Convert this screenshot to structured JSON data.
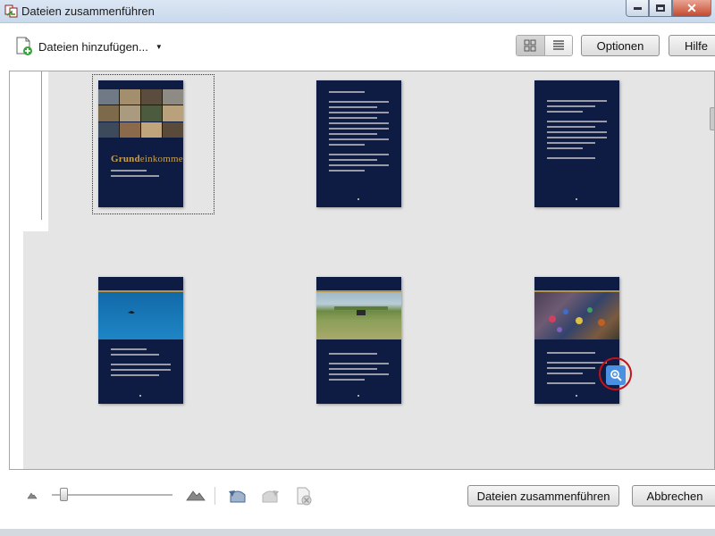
{
  "window": {
    "title": "Dateien zusammenführen",
    "controls": [
      "minimize-icon",
      "maximize-icon",
      "close-icon"
    ],
    "close_glyph": "✕"
  },
  "toolbar": {
    "add_files_label": "Dateien hinzufügen...",
    "dropdown_glyph": "▼",
    "views": [
      "thumbnail-view-icon",
      "list-view-icon"
    ],
    "active_view": "thumbnail-view-icon",
    "options_label": "Optionen",
    "help_label": "Hilfe"
  },
  "thumbnails": [
    {
      "kind": "cover",
      "title_bold": "Grund",
      "title_rest": "einkommen",
      "selected": true
    },
    {
      "kind": "text"
    },
    {
      "kind": "text"
    },
    {
      "kind": "photo-sky"
    },
    {
      "kind": "photo-field"
    },
    {
      "kind": "photo-crowd",
      "hover_zoom": true
    }
  ],
  "colors": {
    "page_bg": "#0e1b42",
    "title_gold": "#c9a04c",
    "zoom_badge": "#4a90e2",
    "highlight_ring": "#c4121c",
    "panel_bg": "#e5e5e5"
  },
  "footer": {
    "zoom_out_icon": "mountain-small-icon",
    "zoom_in_icon": "mountain-large-icon",
    "zoom_slider_value": 0.1,
    "rotate_left_icon": "rotate-left-icon",
    "rotate_right_icon": "rotate-right-icon",
    "delete_icon": "delete-page-icon",
    "merge_label": "Dateien zusammenführen",
    "cancel_label": "Abbrechen"
  }
}
